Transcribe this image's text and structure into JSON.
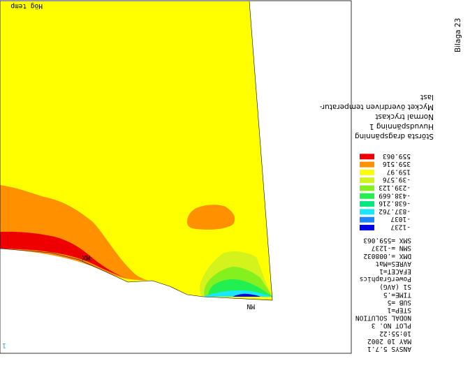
{
  "plot_title": "Hög temp",
  "ansys_info": [
    "ANSYS 5.7.1",
    "MAY 10 2002",
    "10:55:22",
    "PLOT NO.   3",
    "NODAL SOLUTION",
    "STEP=1",
    "SUB =5",
    "TIME=.5",
    "S1       (AVG)",
    "PowerGraphics",
    "EFACET=1",
    "AVRES=Mat",
    "DMX =.008032",
    "SMN =-1237",
    "SMX =559.063"
  ],
  "legend": [
    {
      "label": "-1237",
      "color": "#0000e6"
    },
    {
      "label": "-1037",
      "color": "#1a86ff"
    },
    {
      "label": "-837.762",
      "color": "#19e6ff"
    },
    {
      "label": "-638.216",
      "color": "#00e882"
    },
    {
      "label": "-438.669",
      "color": "#22f050"
    },
    {
      "label": "-239.123",
      "color": "#84f01e"
    },
    {
      "label": "-39.576",
      "color": "#d4f21c"
    },
    {
      "label": "159.97",
      "color": "#ffff00"
    },
    {
      "label": "359.516",
      "color": "#ff9000"
    },
    {
      "label": "559.063",
      "color": "#ee0000"
    }
  ],
  "description_lines": [
    "Största dragspänning",
    "Huvudspänning 1",
    "Normal tryckast",
    "Mycket överdriven temperatur-",
    "last"
  ],
  "page_label": "Bilaga 23",
  "axis_marker": "1",
  "node_labels": [
    "MN",
    "MX"
  ],
  "colors": {
    "frame": "#000000",
    "background": "#ffffff"
  }
}
